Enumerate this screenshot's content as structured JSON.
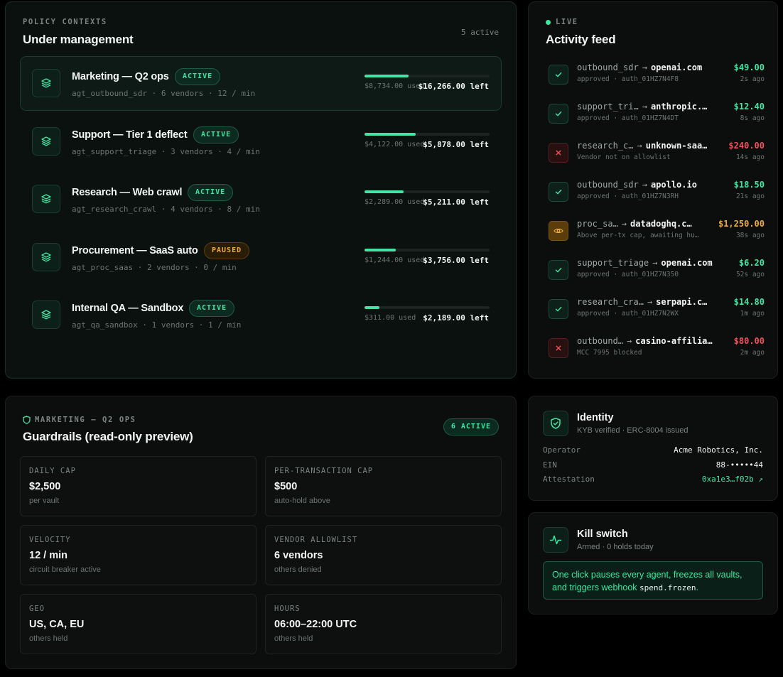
{
  "policy": {
    "eyebrow": "POLICY CONTEXTS",
    "title": "Under management",
    "count": "5 active",
    "rows": [
      {
        "name": "Marketing — Q2 ops",
        "status": "ACTIVE",
        "sub": "agt_outbound_sdr · 6 vendors · 12 / min",
        "used": "$8,734.00 used",
        "left": "$16,266.00 left",
        "progress": 0.35
      },
      {
        "name": "Support — Tier 1 deflect",
        "status": "ACTIVE",
        "sub": "agt_support_triage · 3 vendors · 4 / min",
        "used": "$4,122.00 used",
        "left": "$5,878.00 left",
        "progress": 0.41
      },
      {
        "name": "Research — Web crawl",
        "status": "ACTIVE",
        "sub": "agt_research_crawl · 4 vendors · 8 / min",
        "used": "$2,289.00 used",
        "left": "$5,211.00 left",
        "progress": 0.31
      },
      {
        "name": "Procurement — SaaS auto",
        "status": "PAUSED",
        "sub": "agt_proc_saas · 2 vendors · 0 / min",
        "used": "$1,244.00 used",
        "left": "$3,756.00 left",
        "progress": 0.25
      },
      {
        "name": "Internal QA — Sandbox",
        "status": "ACTIVE",
        "sub": "agt_qa_sandbox · 1 vendors · 1 / min",
        "used": "$311.00 used",
        "left": "$2,189.00 left",
        "progress": 0.12
      }
    ]
  },
  "feed": {
    "eyebrow": "LIVE",
    "title": "Activity feed",
    "items": [
      {
        "agent": "outbound_sdr",
        "vendor": "openai.com",
        "amount": "$49.00",
        "sub": "approved · auth_01HZ7N4F8",
        "time": "2s ago",
        "state": "ok"
      },
      {
        "agent": "support_tri…",
        "vendor": "anthropic.…",
        "amount": "$12.40",
        "sub": "approved · auth_01HZ7N4DT",
        "time": "8s ago",
        "state": "ok"
      },
      {
        "agent": "research_c…",
        "vendor": "unknown-saa…",
        "amount": "$240.00",
        "sub": "Vendor not on allowlist",
        "time": "14s ago",
        "state": "bad"
      },
      {
        "agent": "outbound_sdr",
        "vendor": "apollo.io",
        "amount": "$18.50",
        "sub": "approved · auth_01HZ7N3RH",
        "time": "21s ago",
        "state": "ok"
      },
      {
        "agent": "proc_sa…",
        "vendor": "datadoghq.c…",
        "amount": "$1,250.00",
        "sub": "Above per-tx cap, awaiting hu…",
        "time": "38s ago",
        "state": "warn"
      },
      {
        "agent": "support_triage",
        "vendor": "openai.com",
        "amount": "$6.20",
        "sub": "approved · auth_01HZ7N350",
        "time": "52s ago",
        "state": "ok"
      },
      {
        "agent": "research_cra…",
        "vendor": "serpapi.c…",
        "amount": "$14.80",
        "sub": "approved · auth_01HZ7N2WX",
        "time": "1m ago",
        "state": "ok"
      },
      {
        "agent": "outbound…",
        "vendor": "casino-affilia…",
        "amount": "$80.00",
        "sub": "MCC 7995 blocked",
        "time": "2m ago",
        "state": "bad"
      }
    ]
  },
  "guardrails": {
    "eyebrow": "MARKETING — Q2 OPS",
    "title": "Guardrails (read-only preview)",
    "badge": "6 ACTIVE",
    "cards": [
      {
        "label": "DAILY CAP",
        "value": "$2,500",
        "sub": "per vault"
      },
      {
        "label": "PER-TRANSACTION CAP",
        "value": "$500",
        "sub": "auto-hold above"
      },
      {
        "label": "VELOCITY",
        "value": "12 / min",
        "sub": "circuit breaker active"
      },
      {
        "label": "VENDOR ALLOWLIST",
        "value": "6 vendors",
        "sub": "others denied"
      },
      {
        "label": "GEO",
        "value": "US, CA, EU",
        "sub": "others held"
      },
      {
        "label": "HOURS",
        "value": "06:00–22:00 UTC",
        "sub": "others held"
      }
    ]
  },
  "identity": {
    "title": "Identity",
    "sub": "KYB verified · ERC-8004 issued",
    "rows": [
      {
        "key": "Operator",
        "value": "Acme Robotics, Inc."
      },
      {
        "key": "EIN",
        "value": "88-•••••44"
      },
      {
        "key": "Attestation",
        "value": "0xa1e3…f02b ↗"
      }
    ]
  },
  "kill": {
    "title": "Kill switch",
    "sub": "Armed · 0 holds today",
    "note_prefix": "One click pauses every agent, freezes all vaults, and triggers webhook ",
    "note_code": "spend.frozen",
    "note_suffix": "."
  },
  "colors": {
    "accent": "#3ee6a4",
    "danger": "#f0505a",
    "warning": "#f0a93a"
  }
}
